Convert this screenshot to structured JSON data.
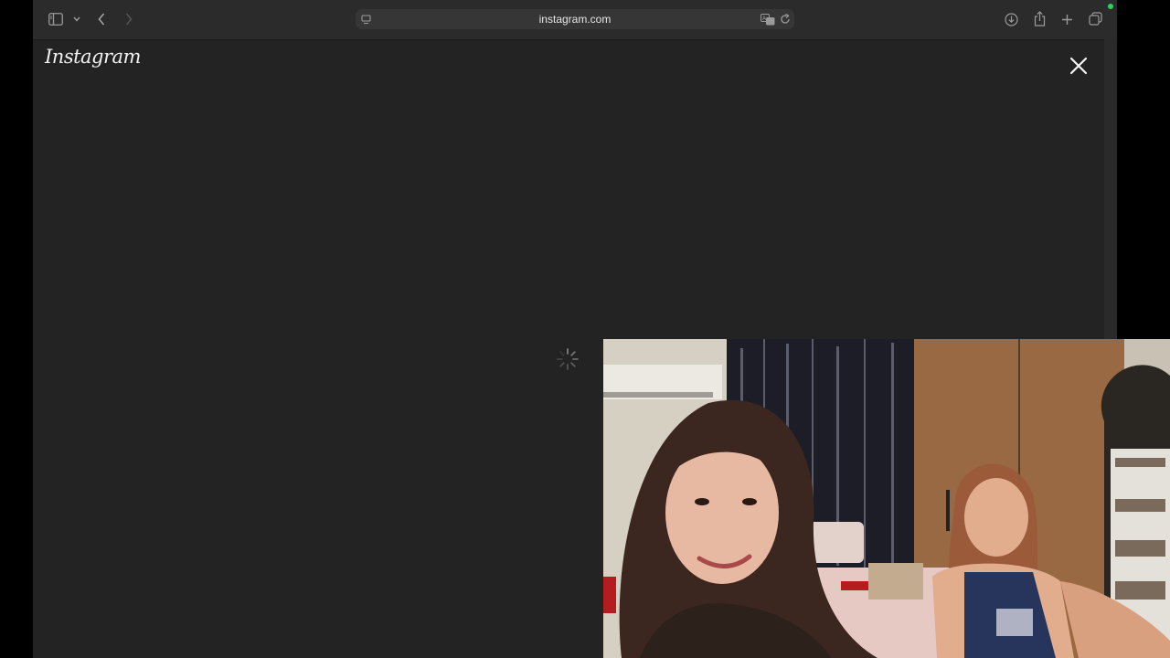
{
  "browser": {
    "url": "instagram.com",
    "icons": [
      "sidebar-icon",
      "chevron-down-icon",
      "back-icon",
      "forward-icon",
      "page-menu-icon",
      "translate-icon",
      "reload-icon",
      "download-icon",
      "share-icon",
      "new-tab-icon",
      "tab-overview-icon"
    ]
  },
  "page": {
    "logo_text": "Instagram",
    "close_icon": "close-icon",
    "loading_icon": "spinner-icon"
  },
  "video": {
    "description_icon": "picture-in-picture-video"
  },
  "colors": {
    "background": "#232323",
    "toolbar": "#2b2b2b",
    "accent_dot": "#30d158"
  }
}
